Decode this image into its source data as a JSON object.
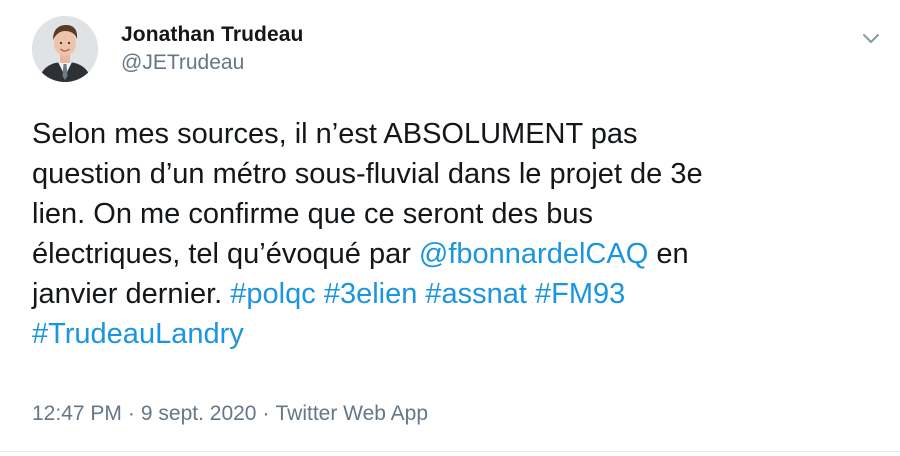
{
  "author": {
    "display_name": "Jonathan Trudeau",
    "handle": "@JETrudeau",
    "avatar_icon": "profile-photo"
  },
  "menu": {
    "icon": "chevron-down-icon"
  },
  "tweet": {
    "lines": [
      [
        {
          "t": "Selon mes sources, il n’est ABSOLUMENT pas"
        }
      ],
      [
        {
          "t": "question d’un métro sous-fluvial dans le projet de 3e"
        }
      ],
      [
        {
          "t": "lien. On me confirme que ce seront des bus"
        }
      ],
      [
        {
          "t": "électriques, tel qu’évoqué par "
        },
        {
          "t": "@fbonnardelCAQ",
          "link": "mention"
        },
        {
          "t": " en"
        }
      ],
      [
        {
          "t": "janvier dernier. "
        },
        {
          "t": "#polqc",
          "link": "hashtag"
        },
        {
          "t": " "
        },
        {
          "t": "#3elien",
          "link": "hashtag"
        },
        {
          "t": " "
        },
        {
          "t": "#assnat",
          "link": "hashtag"
        },
        {
          "t": " "
        },
        {
          "t": "#FM93",
          "link": "hashtag"
        }
      ],
      [
        {
          "t": "#TrudeauLandry",
          "link": "hashtag"
        }
      ]
    ]
  },
  "meta": {
    "time": "12:47 PM",
    "separator": "·",
    "date": "9 sept. 2020",
    "source": "Twitter Web App"
  },
  "colors": {
    "link": "#1b95e0",
    "text": "#14171a",
    "muted": "#657786"
  }
}
